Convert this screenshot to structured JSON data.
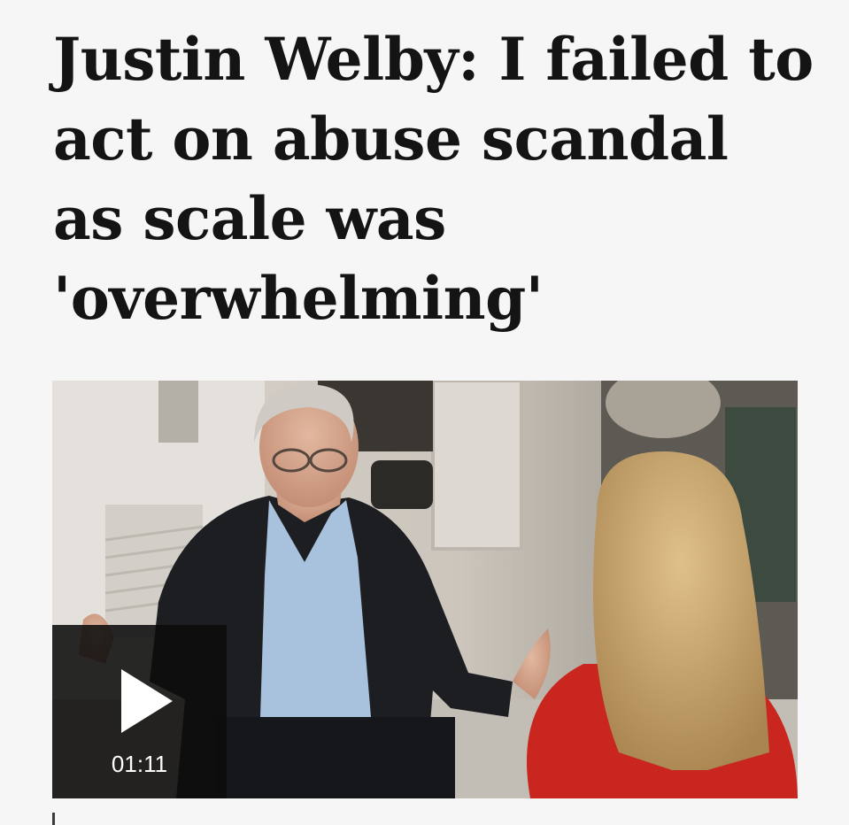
{
  "article": {
    "headline": "Justin Welby: I failed to act on abuse scandal as scale was 'overwhelming'"
  },
  "video": {
    "duration": "01:11",
    "play_icon": "play-icon"
  },
  "caption": {
    "text": ""
  },
  "colors": {
    "background": "#f6f6f6",
    "headline": "#141414",
    "play_overlay": "#0c0c0c",
    "interviewer_top": "#c8261f"
  }
}
